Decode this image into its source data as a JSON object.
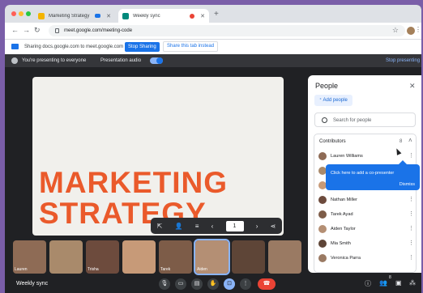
{
  "browser": {
    "tabs": [
      {
        "title": "Marketing Strategy",
        "favicon_color": "#f4b400"
      },
      {
        "title": "Weekly sync",
        "favicon_color": "#00897b"
      }
    ],
    "new_tab": "+",
    "url": "meet.google.com/meeting-code"
  },
  "sharebar": {
    "text": "Sharing docs.google.com to meet.google.com",
    "stop_button": "Stop Sharing",
    "share_tab_button": "Share this tab instead"
  },
  "presenting": {
    "text": "You're presenting to everyone",
    "audio_label": "Presentation audio",
    "audio_on": true,
    "stop": "Stop presenting"
  },
  "slide": {
    "title": "MARKETING\nSTRATEGY",
    "page": "1"
  },
  "participants": [
    {
      "name": "Lauren",
      "color": "#8e6b55"
    },
    {
      "name": "",
      "color": "#a98a6b"
    },
    {
      "name": "Trisha",
      "color": "#6d4b3d"
    },
    {
      "name": "",
      "color": "#c79a78"
    },
    {
      "name": "Tarek",
      "color": "#7d5c48"
    },
    {
      "name": "Aiden",
      "color": "#b48f74"
    },
    {
      "name": "",
      "color": "#5e4537"
    },
    {
      "name": "",
      "color": "#9a7a63"
    }
  ],
  "people_panel": {
    "title": "People",
    "add_people": "Add people",
    "search_placeholder": "Search for people",
    "section": "Contributors",
    "count": "8",
    "people": [
      {
        "name": "Lauren Williams",
        "color": "#8e6b55"
      },
      {
        "name": "",
        "color": "#a98a6b"
      },
      {
        "name": "",
        "color": "#c79a78"
      },
      {
        "name": "Nathan Miller",
        "color": "#6d4b3d"
      },
      {
        "name": "Tarek Ayad",
        "color": "#7d5c48"
      },
      {
        "name": "Aiden Taylor",
        "color": "#b48f74"
      },
      {
        "name": "Mia Smith",
        "color": "#5e4537"
      },
      {
        "name": "Veronica Parra",
        "color": "#9a7a63"
      }
    ],
    "tooltip": {
      "text": "Click here to add a co-presenter",
      "dismiss": "Dismiss"
    }
  },
  "bottom": {
    "meeting_name": "Weekly sync",
    "people_count": "8"
  }
}
